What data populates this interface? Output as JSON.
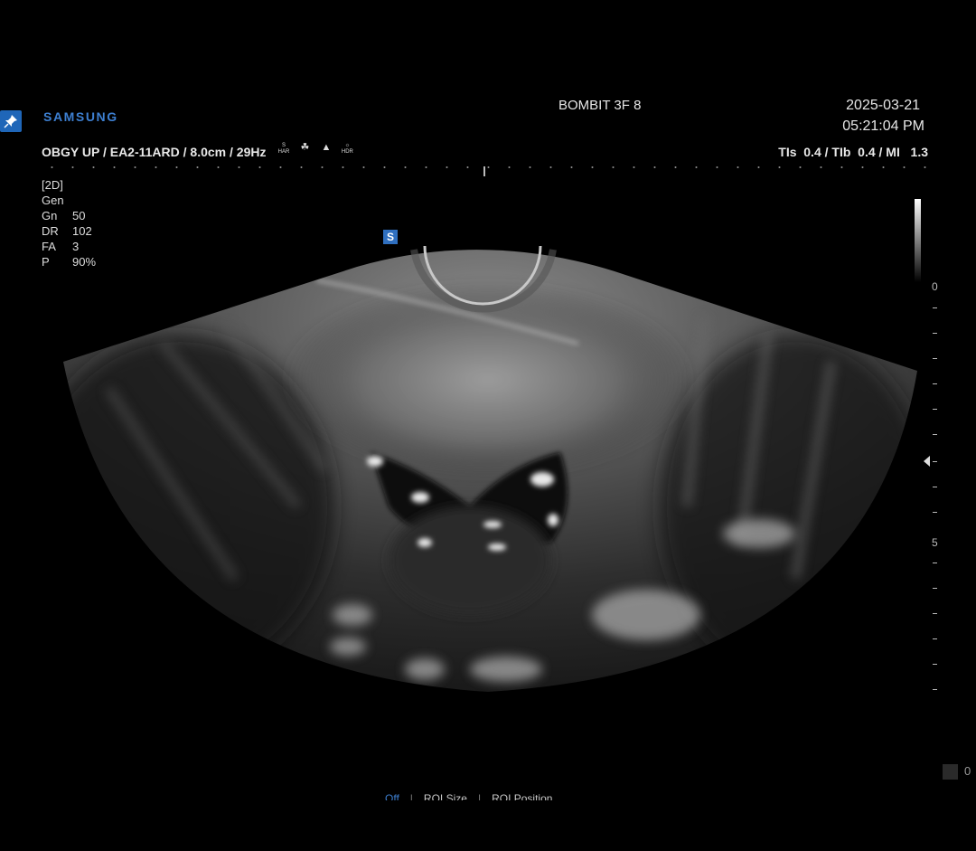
{
  "header": {
    "brand": "SAMSUNG",
    "site": "BOMBIT 3F 8",
    "date": "2025-03-21",
    "time": "05:21:04 PM",
    "pin_icon": "pin-icon"
  },
  "scan": {
    "params": "OBGY UP / EA2-11ARD / 8.0cm / 29Hz",
    "mode_icons": [
      {
        "icon": "s-har-icon",
        "top": "S",
        "bottom": "HAR"
      },
      {
        "icon": "clear-icon",
        "top": "",
        "bottom": ""
      },
      {
        "icon": "mv-icon",
        "top": "",
        "bottom": ""
      },
      {
        "icon": "hdr-icon",
        "top": "",
        "bottom": "HDR"
      }
    ],
    "indices": "TIs  0.4 / TIb  0.4 / MI   1.3"
  },
  "presets": {
    "mode": "[2D]",
    "freq": "Gen",
    "rows": [
      {
        "key": "Gn",
        "value": "50"
      },
      {
        "key": "DR",
        "value": "102"
      },
      {
        "key": "FA",
        "value": "3"
      },
      {
        "key": "P",
        "value": "90%"
      }
    ]
  },
  "image": {
    "orientation_marker": "S"
  },
  "depth_scale": {
    "labels": [
      "0",
      "5"
    ]
  },
  "bottom": {
    "indicator_value": "0",
    "softkeys": [
      "Off",
      "ROI Size",
      "ROI Position"
    ],
    "active_softkey": "Off"
  },
  "colors": {
    "accent": "#3d7fd1",
    "background": "#000000",
    "text": "#e6e6e6"
  }
}
